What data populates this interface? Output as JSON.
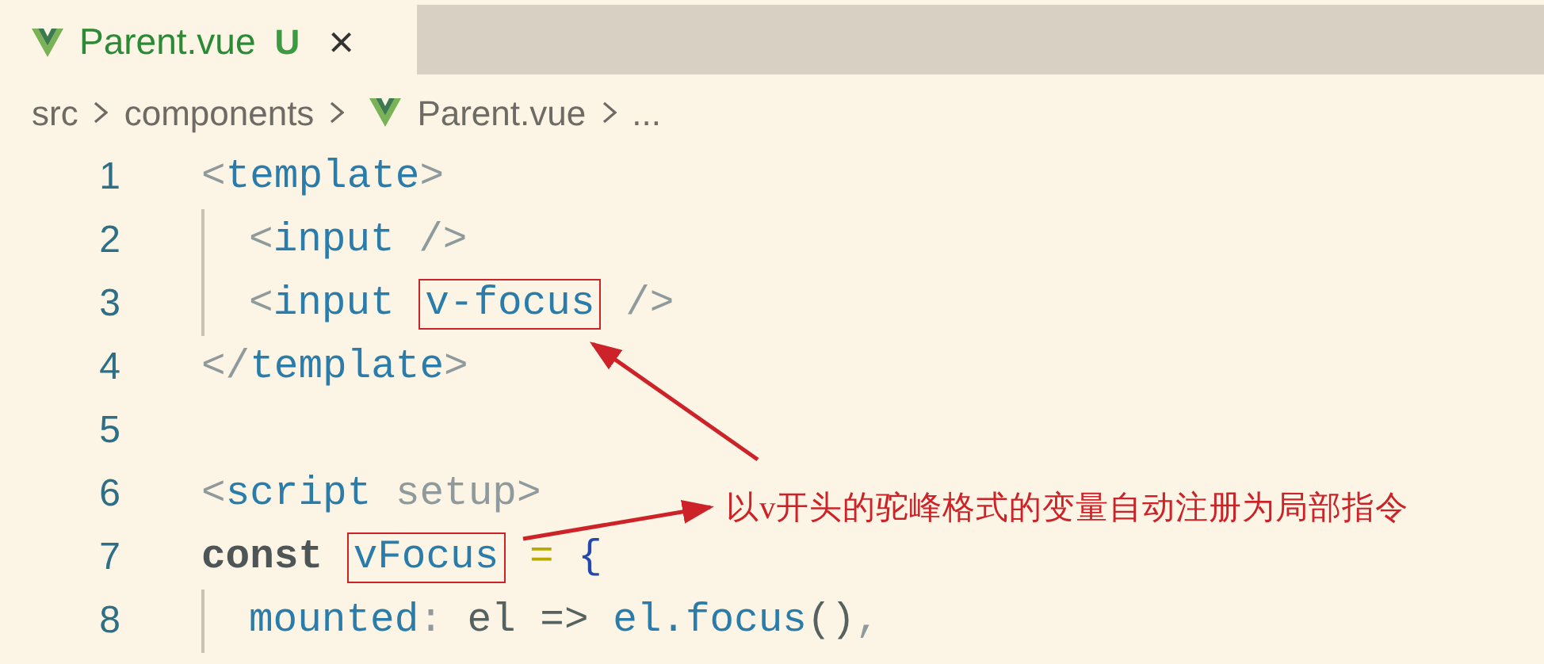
{
  "tab": {
    "label": "Parent.vue",
    "badge": "U",
    "close": "×"
  },
  "breadcrumb": [
    {
      "text": "src",
      "kind": "folder"
    },
    {
      "text": "components",
      "kind": "folder"
    },
    {
      "text": "Parent.vue",
      "kind": "vue-file"
    },
    {
      "text": "...",
      "kind": "more"
    }
  ],
  "code_lines": [
    {
      "number": "1",
      "indented": false,
      "tokens": [
        {
          "text": "<",
          "kind": "punct"
        },
        {
          "text": "template",
          "kind": "tag"
        },
        {
          "text": ">",
          "kind": "punct"
        }
      ]
    },
    {
      "number": "2",
      "indented": true,
      "tokens": [
        {
          "text": "<",
          "kind": "punct"
        },
        {
          "text": "input",
          "kind": "tag"
        },
        {
          "text": " />",
          "kind": "punct"
        }
      ]
    },
    {
      "number": "3",
      "indented": true,
      "tokens": [
        {
          "text": "<",
          "kind": "punct"
        },
        {
          "text": "input ",
          "kind": "tag"
        },
        {
          "text": "v-focus",
          "kind": "attr",
          "boxed": true
        },
        {
          "text": " />",
          "kind": "punct"
        }
      ]
    },
    {
      "number": "4",
      "indented": false,
      "tokens": [
        {
          "text": "</",
          "kind": "punct"
        },
        {
          "text": "template",
          "kind": "tag"
        },
        {
          "text": ">",
          "kind": "punct"
        }
      ]
    },
    {
      "number": "5",
      "indented": false
    },
    {
      "number": "6",
      "indented": false,
      "tokens": [
        {
          "text": "<",
          "kind": "punct"
        },
        {
          "text": "script",
          "kind": "tag"
        },
        {
          "text": " setup>",
          "kind": "punct"
        }
      ]
    },
    {
      "number": "7",
      "indented": false,
      "tokens": [
        {
          "text": "const ",
          "kind": "keyword"
        },
        {
          "text": "vFocus",
          "kind": "variable",
          "boxed": true
        },
        {
          "text": " = ",
          "kind": "operator"
        },
        {
          "text": "{",
          "kind": "brace"
        }
      ]
    },
    {
      "number": "8",
      "indented": true,
      "tokens": [
        {
          "text": "mounted",
          "kind": "property"
        },
        {
          "text": ": ",
          "kind": "punct"
        },
        {
          "text": "el => ",
          "kind": "plain"
        },
        {
          "text": "el.focus",
          "kind": "property"
        },
        {
          "text": "()",
          "kind": "plain"
        },
        {
          "text": ",",
          "kind": "punct"
        }
      ]
    }
  ],
  "annotation": {
    "text": "以v开头的驼峰格式的变量自动注册为局部指令"
  }
}
